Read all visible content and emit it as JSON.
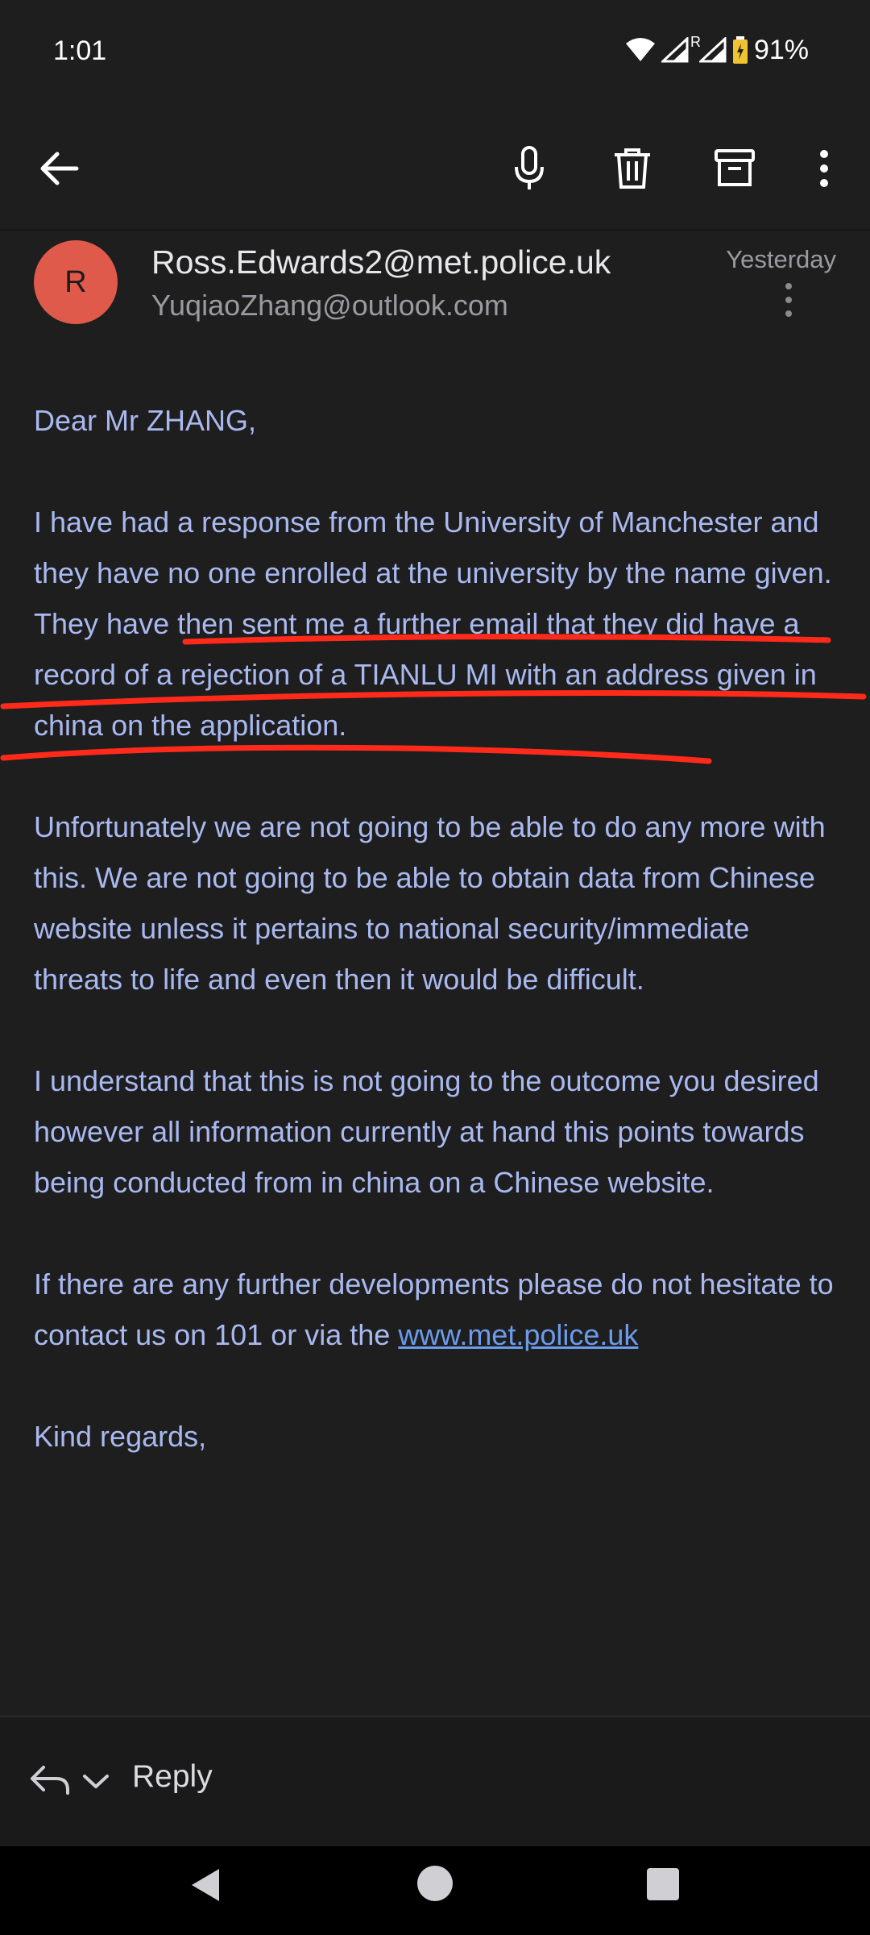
{
  "status": {
    "time": "1:01",
    "battery": "91%",
    "roaming_mark": "R"
  },
  "toolbar": {
    "icons": [
      "back-arrow-icon",
      "microphone-icon",
      "trash-icon",
      "archive-icon",
      "more-vert-icon"
    ]
  },
  "email": {
    "avatar_letter": "R",
    "from": "Ross.Edwards2@met.police.uk",
    "to": "YuqiaoZhang@outlook.com",
    "date": "Yesterday",
    "greeting": "Dear Mr ZHANG,",
    "paragraphs": [
      "I have had a response from the University of Manchester and they have no one enrolled at the university by the name given. They have then sent me a further email that they did have a record of a rejection of a TIANLU MI with an address given in china on the application.",
      "Unfortunately we are not going to be able to do any more with this. We are not going to be able to obtain data from Chinese website unless it pertains to national security/immediate threats to life and even then it would be difficult.",
      "I understand that this is not going to the outcome you desired however all information currently at hand this points towards being conducted from in china on a Chinese website."
    ],
    "closing_text": "If there are any further developments please do not hesitate to contact us on 101 or via the",
    "link": "www.met.police.uk",
    "signoff": "Kind regards,"
  },
  "reply": {
    "label": "Reply"
  },
  "colors": {
    "background": "#1e1e1f",
    "body_text": "#a9b9f0",
    "link": "#6b9bea",
    "avatar": "#e05a4c",
    "annotation": "#ff2a1a"
  }
}
